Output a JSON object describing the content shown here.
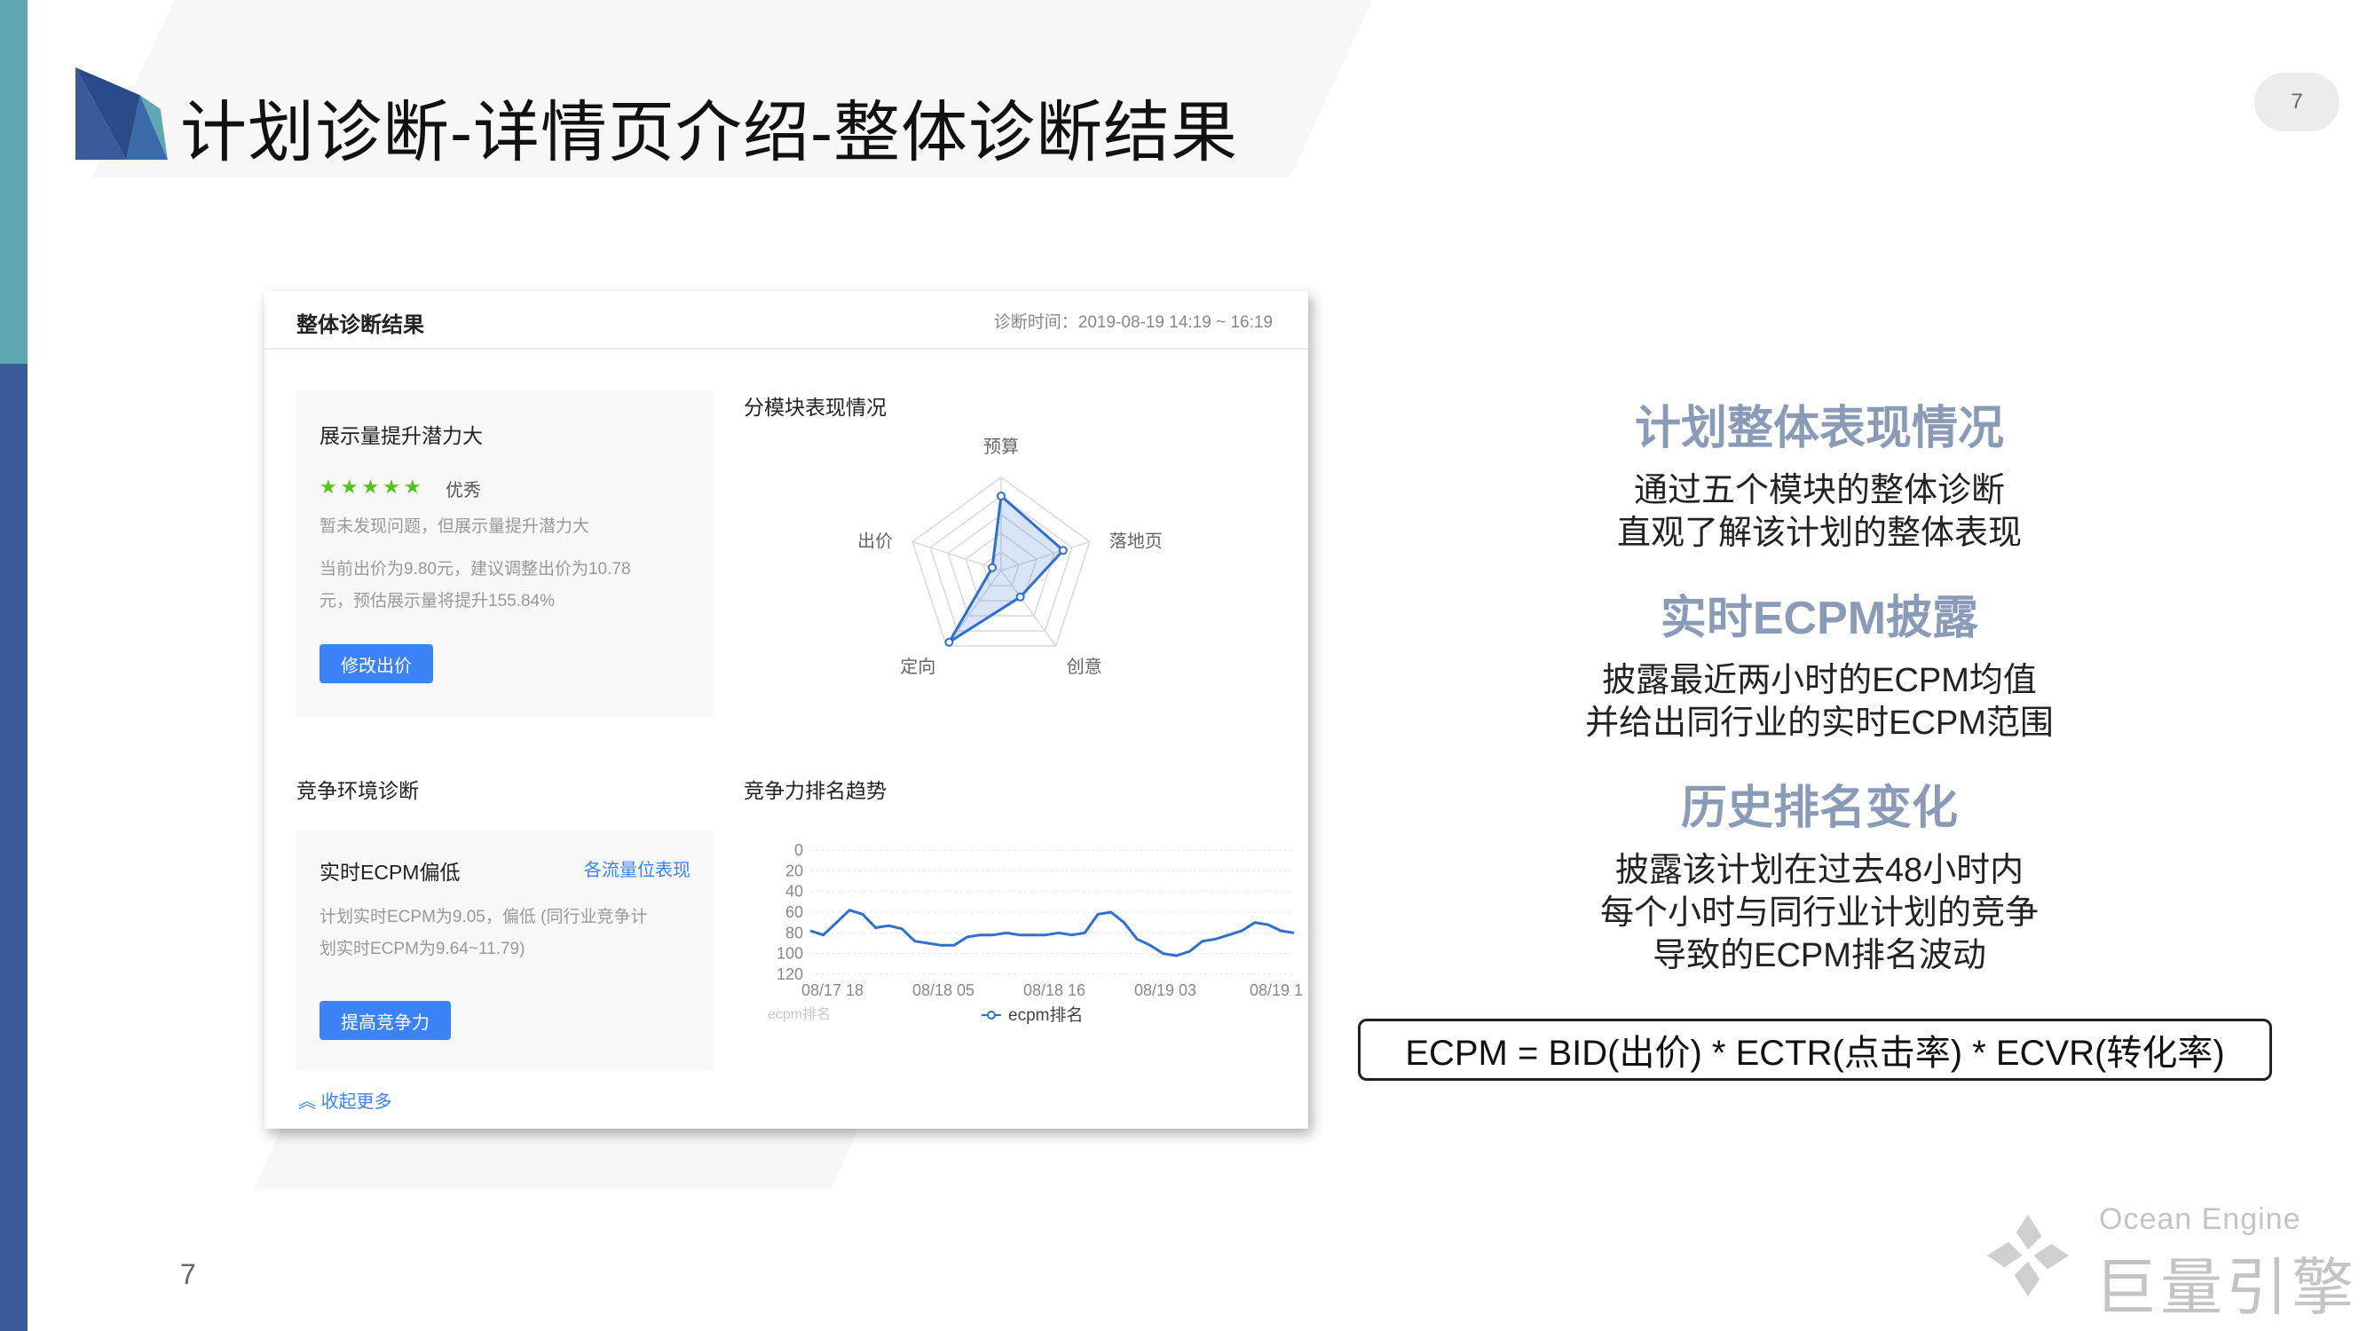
{
  "slide": {
    "title": "计划诊断-详情页介绍-整体诊断结果",
    "page_number": "7"
  },
  "panel": {
    "title": "整体诊断结果",
    "diag_time": "诊断时间：2019-08-19 14:19 ~ 16:19",
    "card1": {
      "title": "展示量提升潜力大",
      "stars": "★★★★★",
      "rating": "优秀",
      "desc1": "暂未发现问题，但展示量提升潜力大",
      "desc2_line1": "当前出价为9.80元，建议调整出价为10.78",
      "desc2_line2": "元，预估展示量将提升155.84%",
      "button": "修改出价"
    },
    "radar_section_label": "分模块表现情况",
    "competition_section_label": "竞争环境诊断",
    "card2": {
      "title": "实时ECPM偏低",
      "link": "各流量位表现",
      "desc_line1": "计划实时ECPM为9.05，偏低 (同行业竞争计",
      "desc_line2": "划实时ECPM为9.64~11.79)",
      "button": "提高竞争力"
    },
    "trend_section_label": "竞争力排名趋势",
    "collapse_link": "收起更多"
  },
  "radar": {
    "axes": [
      "预算",
      "落地页",
      "创意",
      "定向",
      "出价"
    ],
    "values": [
      0.8,
      0.7,
      0.35,
      0.95,
      0.1
    ],
    "color": "#2f6fd1"
  },
  "chart_data": {
    "type": "line",
    "title": "竞争力排名趋势",
    "xlabel": "",
    "ylabel": "",
    "y_reversed": true,
    "ylim": [
      0,
      120
    ],
    "yticks": [
      0,
      20,
      40,
      60,
      80,
      100,
      120
    ],
    "x_ticks": [
      "08/17 18",
      "08/18 05",
      "08/18 16",
      "08/19 03",
      "08/19 1"
    ],
    "y_axis_note": "ecpm排名",
    "series": [
      {
        "name": "ecpm排名",
        "color": "#2f6fd1",
        "values": [
          78,
          82,
          70,
          58,
          62,
          75,
          73,
          76,
          88,
          90,
          92,
          92,
          84,
          82,
          82,
          80,
          82,
          82,
          82,
          80,
          82,
          80,
          62,
          60,
          70,
          86,
          92,
          100,
          102,
          98,
          88,
          86,
          82,
          78,
          70,
          72,
          78,
          80
        ]
      }
    ],
    "legend_position": "bottom"
  },
  "explain": [
    {
      "heading": "计划整体表现情况",
      "lines": [
        "通过五个模块的整体诊断",
        "直观了解该计划的整体表现"
      ]
    },
    {
      "heading": "实时ECPM披露",
      "lines": [
        "披露最近两小时的ECPM均值",
        "并给出同行业的实时ECPM范围"
      ]
    },
    {
      "heading": "历史排名变化",
      "lines": [
        "披露该计划在过去48小时内",
        "每个小时与同行业计划的竞争",
        "导致的ECPM排名波动"
      ]
    }
  ],
  "formula": "ECPM =   BID(出价) * ECTR(点击率) * ECVR(转化率)",
  "brand": {
    "en": "Ocean Engine",
    "cn": "巨量引擎"
  }
}
